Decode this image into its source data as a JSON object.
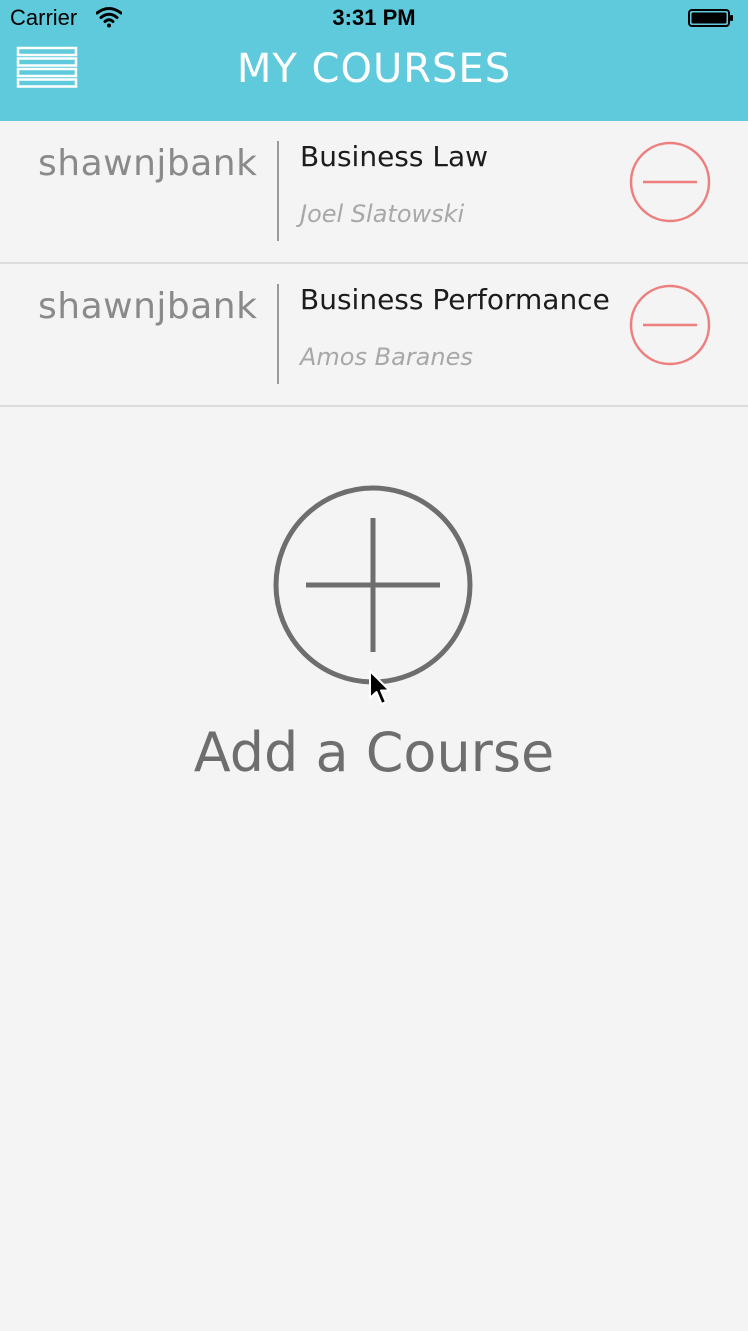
{
  "status_bar": {
    "carrier": "Carrier",
    "time": "3:31 PM"
  },
  "nav": {
    "title": "MY COURSES",
    "menu_icon": "hamburger-menu-icon"
  },
  "courses": [
    {
      "user": "shawnjbank",
      "title": "Business Law",
      "instructor": "Joel Slatowski",
      "remove_icon": "minus-circle-icon"
    },
    {
      "user": "shawnjbank",
      "title": "Business Performance",
      "instructor": "Amos Baranes",
      "remove_icon": "minus-circle-icon"
    }
  ],
  "add_course": {
    "label": "Add a Course",
    "icon": "plus-circle-icon"
  },
  "colors": {
    "header": "#5ecadb",
    "remove": "#ee7f7f",
    "add": "#6e6e6e",
    "background": "#f4f4f4"
  }
}
